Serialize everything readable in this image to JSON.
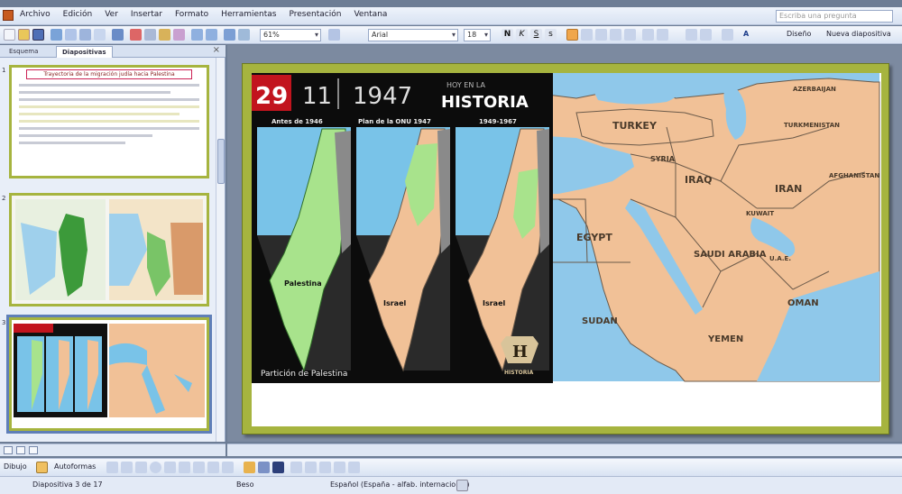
{
  "menu": {
    "items": [
      "Archivo",
      "Edición",
      "Ver",
      "Insertar",
      "Formato",
      "Herramientas",
      "Presentación",
      "Ventana"
    ],
    "help_placeholder": "Escriba una pregunta"
  },
  "toolbar": {
    "zoom": "61%",
    "font": "Arial",
    "size": "18",
    "design_label": "Diseño",
    "new_slide_label": "Nueva diapositiva"
  },
  "panel": {
    "tab_outline": "Esquema",
    "tab_slides": "Diapositivas",
    "close": "×",
    "slide_numbers": [
      "1",
      "2",
      "3"
    ],
    "slide1_title": "Trayectoria de la migración judía hacia Palestina"
  },
  "slide": {
    "day": "29",
    "month": "11",
    "year": "1947",
    "hoy": "HOY EN LA",
    "historia": "HISTORIA",
    "panel_titles": [
      "Antes de 1946",
      "Plan de la ONU 1947",
      "1949-1967"
    ],
    "panel_labels": [
      "Palestina",
      "Israel",
      "Israel"
    ],
    "caption": "Partición de Palestina",
    "logo_letter": "H",
    "logo_text": "HISTORIA",
    "map_labels": {
      "turkey": "TURKEY",
      "syria": "SYRIA",
      "iraq": "IRAQ",
      "iran": "IRAN",
      "egypt": "EGYPT",
      "saudi": "SAUDI ARABIA",
      "sudan": "SUDAN",
      "yemen": "YEMEN",
      "oman": "OMAN",
      "uae": "U.A.E.",
      "azerbaijan": "AZERBAIJAN",
      "turkmenistan": "TURKMENISTAN",
      "kuwait": "KUWAIT",
      "afghanistan": "AFGHANISTAN"
    }
  },
  "drawbar": {
    "dibujo": "Dibujo",
    "autoformas": "Autoformas"
  },
  "status": {
    "slide_count": "Diapositiva 3 de 17",
    "design": "Beso",
    "language": "Español (España - alfab. internacional)"
  },
  "colors": {
    "accent_green": "#a6b43f",
    "sea": "#79c3e8",
    "land": "#f1c197",
    "green_land": "#a8e38c",
    "red_box": "#c2141e"
  }
}
